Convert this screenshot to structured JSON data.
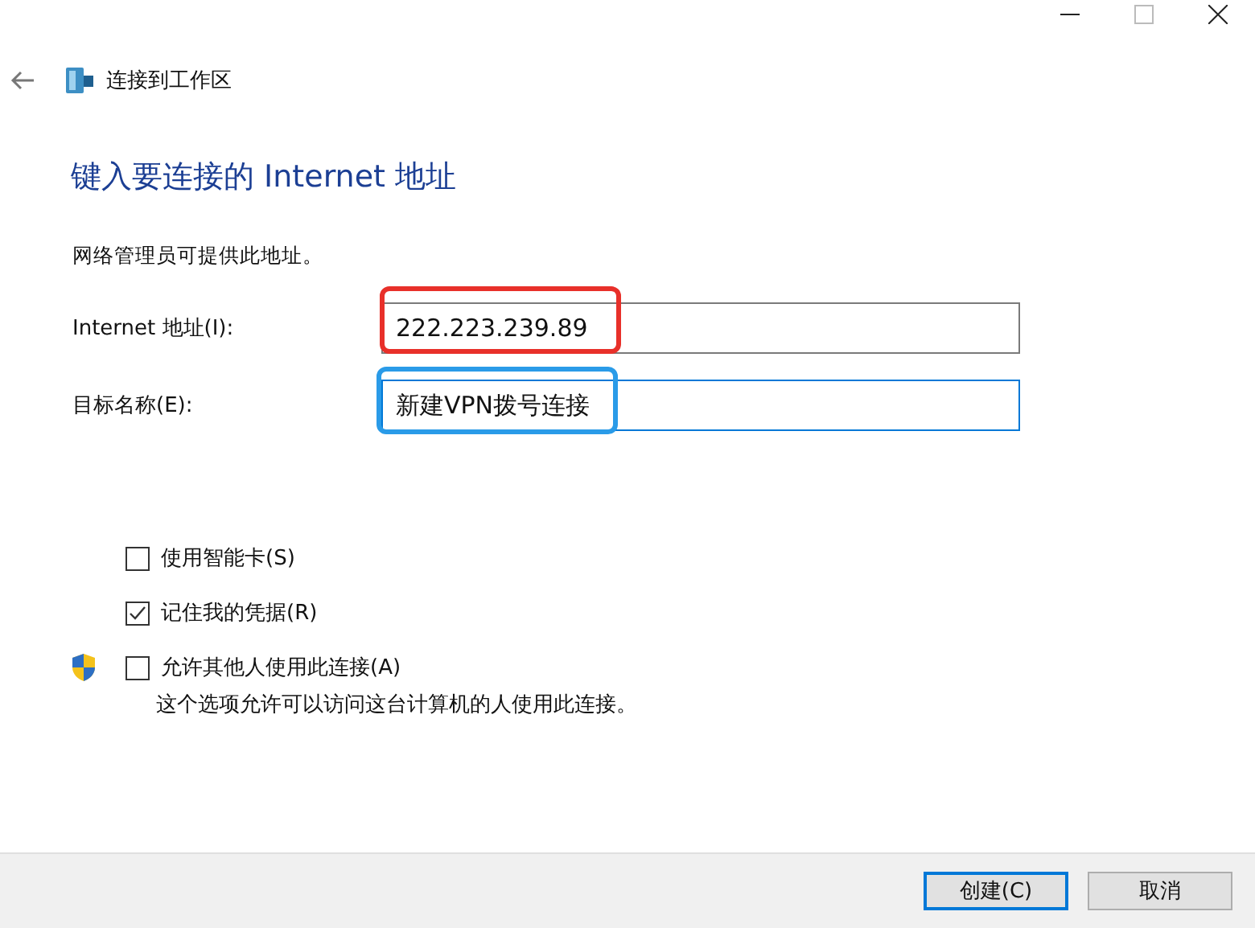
{
  "window": {
    "title": "连接到工作区"
  },
  "heading": "键入要连接的 Internet 地址",
  "hint": "网络管理员可提供此地址。",
  "fields": [
    {
      "label": "Internet 地址(I):",
      "value": "222.223.239.89",
      "focused": false,
      "highlight": {
        "color": "#e8302a"
      }
    },
    {
      "label": "目标名称(E):",
      "value": "新建VPN拨号连接",
      "focused": true,
      "highlight": {
        "color": "#2a9be8"
      }
    }
  ],
  "options": [
    {
      "label": "使用智能卡(S)",
      "checked": false,
      "shield": false
    },
    {
      "label": "记住我的凭据(R)",
      "checked": true,
      "shield": false
    },
    {
      "label": "允许其他人使用此连接(A)",
      "checked": false,
      "shield": true,
      "description": "这个选项允许可以访问这台计算机的人使用此连接。"
    }
  ],
  "buttons": [
    {
      "label": "创建(C)",
      "default": true
    },
    {
      "label": "取消",
      "default": false
    }
  ]
}
